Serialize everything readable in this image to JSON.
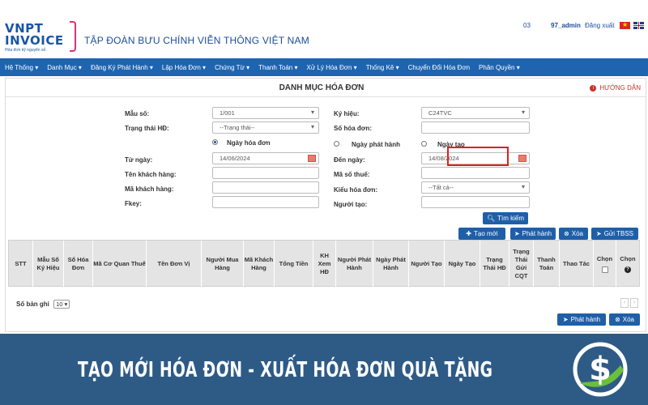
{
  "header": {
    "logo_line1": "VNPT",
    "logo_line2": "INVOICE",
    "logo_tagline": "Hóa đơn kỹ nguyên số",
    "org_name": "TẬP ĐOÀN BƯU CHÍNH VIỄN THÔNG VIỆT NAM",
    "user_id": "03",
    "username": "97_admin",
    "logout": "Đăng xuất"
  },
  "nav": [
    {
      "label": "Hệ Thống ▾"
    },
    {
      "label": "Danh Mục ▾"
    },
    {
      "label": "Đăng Ký Phát Hành ▾"
    },
    {
      "label": "Lập Hóa Đơn ▾"
    },
    {
      "label": "Chứng Từ ▾"
    },
    {
      "label": "Thanh Toán ▾"
    },
    {
      "label": "Xử Lý Hóa Đơn ▾"
    },
    {
      "label": "Thống Kê ▾"
    },
    {
      "label": "Chuyển Đổi Hóa Đơn"
    },
    {
      "label": "Phân Quyền ▾"
    }
  ],
  "page": {
    "title": "DANH MỤC HÓA ĐƠN",
    "help": "HƯỚNG DẪN"
  },
  "form": {
    "mau_so_label": "Mẫu số:",
    "mau_so_value": "1/001",
    "trang_thai_label": "Trạng thái HĐ:",
    "trang_thai_value": "--Trạng thái--",
    "ky_hieu_label": "Ký hiệu:",
    "ky_hieu_value": "C24TVC",
    "so_hoa_don_label": "Số hóa đơn:",
    "radio_ngay_hoa_don": "Ngày hóa đơn",
    "radio_ngay_phat_hanh": "Ngày phát hành",
    "radio_ngay_tao": "Ngày tạo",
    "tu_ngay_label": "Từ ngày:",
    "tu_ngay_value": "14/06/2024",
    "den_ngay_label": "Đến ngày:",
    "den_ngay_value": "14/08/2024",
    "ten_khach_hang_label": "Tên khách hàng:",
    "ma_so_thue_label": "Mã số thuế:",
    "ma_khach_hang_label": "Mã khách hàng:",
    "kieu_hoa_don_label": "Kiểu hóa đơn:",
    "kieu_hoa_don_value": "--Tất cả--",
    "fkey_label": "Fkey:",
    "nguoi_tao_label": "Người tạo:"
  },
  "buttons": {
    "search": "Tìm kiếm",
    "create": "Tạo mới",
    "publish": "Phát hành",
    "delete": "Xóa",
    "send_tbss": "Gửi TBSS",
    "publish_bottom": "Phát hành",
    "delete_bottom": "Xóa"
  },
  "table": {
    "columns": [
      "STT",
      "Mẫu Số Ký Hiệu",
      "Số Hóa Đơn",
      "Mã Cơ Quan Thuế",
      "Tên Đơn Vị",
      "Người Mua Hàng",
      "Mã Khách Hàng",
      "Tổng Tiền",
      "KH Xem HĐ",
      "Người Phát Hành",
      "Ngày Phát Hành",
      "Người Tạo",
      "Ngày Tạo",
      "Trạng Thái HĐ",
      "Trạng Thái Gửi CQT",
      "Thanh Toán",
      "Thao Tác",
      "Chọn",
      "Chọn"
    ]
  },
  "footer": {
    "records_label": "Số bản ghi",
    "records_value": "10"
  },
  "banner": {
    "text": "TẠO MỚI HÓA ĐƠN - XUẤT HÓA ĐƠN QUÀ TẶNG"
  },
  "colors": {
    "nav_bg": "#1e64b0",
    "button_bg": "#1f5fa8",
    "banner_bg": "#2e5b86",
    "highlight": "#e0201b",
    "brand": "#1a55a6"
  }
}
